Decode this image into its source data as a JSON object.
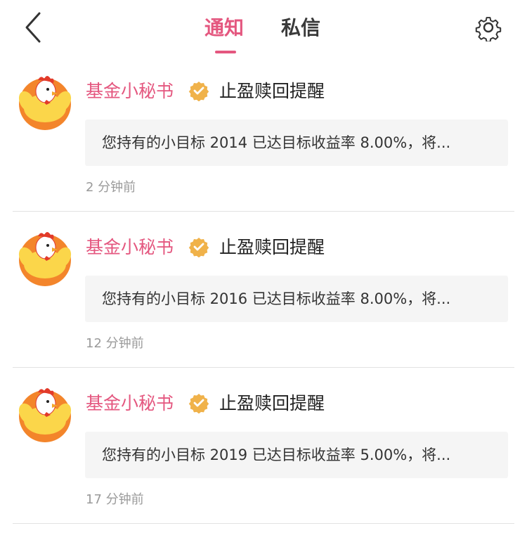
{
  "header": {
    "tabs": [
      {
        "label": "通知",
        "active": true
      },
      {
        "label": "私信",
        "active": false
      }
    ],
    "back_icon": "chevron-left-icon",
    "settings_icon": "gear-icon"
  },
  "colors": {
    "accent": "#e4577f",
    "verified_badge": "#f0b24a",
    "bubble_bg": "#f5f5f5",
    "time_text": "#9a9a9a"
  },
  "notifications": [
    {
      "sender": "基金小秘书",
      "verified_icon": "verified-badge-icon",
      "title": "止盈赎回提醒",
      "message": "您持有的小目标 2014 已达目标收益率 8.00%，将...",
      "time": "2 分钟前"
    },
    {
      "sender": "基金小秘书",
      "verified_icon": "verified-badge-icon",
      "title": "止盈赎回提醒",
      "message": "您持有的小目标 2016 已达目标收益率 8.00%，将...",
      "time": "12 分钟前"
    },
    {
      "sender": "基金小秘书",
      "verified_icon": "verified-badge-icon",
      "title": "止盈赎回提醒",
      "message": "您持有的小目标 2019 已达目标收益率 5.00%，将...",
      "time": "17 分钟前"
    }
  ]
}
